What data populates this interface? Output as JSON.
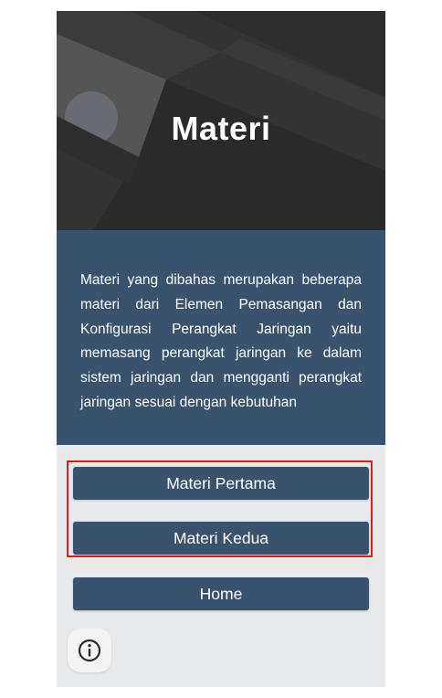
{
  "header": {
    "title": "Materi"
  },
  "description": {
    "text": "Materi yang dibahas merupakan beberapa materi dari Elemen Pemasangan dan Konfigurasi Perangkat Jaringan yaitu memasang perangkat jaringan ke dalam sistem jaringan dan mengganti perangkat jaringan sesuai dengan kebutuhan"
  },
  "buttons": {
    "first_label": "Materi Pertama",
    "second_label": "Materi Kedua",
    "home_label": "Home"
  },
  "icons": {
    "info": "info-icon"
  },
  "colors": {
    "primary": "#39526e",
    "highlight_border": "#e41b1b",
    "hero_background": "#2d2d2d",
    "page_background": "#e8e9eb"
  }
}
